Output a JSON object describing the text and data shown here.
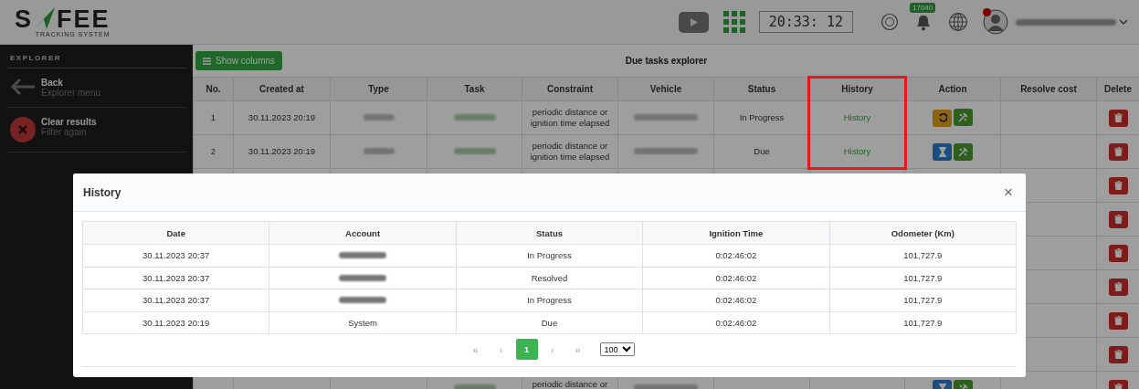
{
  "header": {
    "logo": {
      "left": "S",
      "right": "FEE",
      "tagline": "TRACKING SYSTEM"
    },
    "clock": "20:33: 12",
    "notification_count": "17040"
  },
  "sidebar": {
    "title": "EXPLORER",
    "items": [
      {
        "kind": "back",
        "title": "Back",
        "subtitle": "Explorer menu"
      },
      {
        "kind": "clear",
        "title": "Clear results",
        "subtitle": "Filter again"
      }
    ]
  },
  "main": {
    "show_columns_button": "Show columns",
    "title": "Due tasks explorer",
    "columns": [
      {
        "label": "No."
      },
      {
        "label": "Created at"
      },
      {
        "label": "Type"
      },
      {
        "label": "Task"
      },
      {
        "label": "Constraint"
      },
      {
        "label": "Vehicle"
      },
      {
        "label": "Status"
      },
      {
        "label": "History",
        "highlighted": true
      },
      {
        "label": "Action"
      },
      {
        "label": "Resolve cost"
      },
      {
        "label": "Delete"
      }
    ],
    "rows": [
      {
        "no": "1",
        "created_at": "30.11.2023 20:19",
        "constraint": "periodic distance or ignition time elapsed",
        "status": "In Progress",
        "history": "History",
        "action": {
          "kind": "reset"
        }
      },
      {
        "no": "2",
        "created_at": "30.11.2023 20:19",
        "constraint": "periodic distance or ignition time elapsed",
        "status": "Due",
        "history": "History",
        "action": {
          "kind": "pending"
        }
      },
      {},
      {},
      {},
      {},
      {},
      {},
      {
        "constraint": "periodic distance or",
        "action": {
          "kind": "pending"
        }
      }
    ]
  },
  "modal": {
    "title": "History",
    "close": "×",
    "columns": [
      "Date",
      "Account",
      "Status",
      "Ignition Time",
      "Odometer (Km)"
    ],
    "rows": [
      {
        "date": "30.11.2023 20:37",
        "status": "In Progress",
        "ignition_time": "0:02:46:02",
        "odometer": "101,727.9"
      },
      {
        "date": "30.11.2023 20:37",
        "status": "Resolved",
        "ignition_time": "0:02:46:02",
        "odometer": "101,727.9"
      },
      {
        "date": "30.11.2023 20:37",
        "status": "In Progress",
        "ignition_time": "0:02:46:02",
        "odometer": "101,727.9"
      },
      {
        "date": "30.11.2023 20:19",
        "account": "System",
        "status": "Due",
        "ignition_time": "0:02:46:02",
        "odometer": "101,727.9"
      }
    ],
    "pagination": [
      {
        "label": "«",
        "selected": false
      },
      {
        "label": "‹",
        "selected": false
      },
      {
        "label": "1",
        "selected": true
      },
      {
        "label": "›",
        "selected": false
      },
      {
        "label": "»",
        "selected": false
      }
    ],
    "page_size": "100"
  }
}
